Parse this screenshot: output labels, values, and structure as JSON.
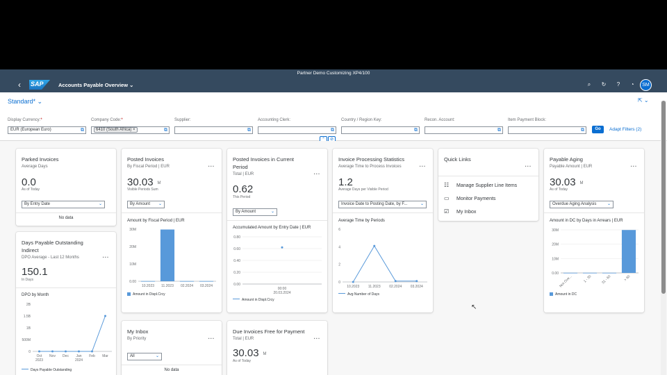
{
  "shell": {
    "system": "Partner Demo Customizing  XP4/100",
    "logo": "SAP",
    "app_title": "Accounts Payable Overview",
    "avatar": "SM"
  },
  "filterbar": {
    "variant": "Standard",
    "variant_star": "*",
    "filters": [
      {
        "label": "Display Currency:",
        "required": true,
        "value": "EUR (European Euro)",
        "token": false
      },
      {
        "label": "Company Code:",
        "required": true,
        "value": "6410 (South Africa)",
        "token": true
      },
      {
        "label": "Supplier:",
        "required": false,
        "value": "",
        "token": false
      },
      {
        "label": "Accounting Clerk:",
        "required": false,
        "value": "",
        "token": false
      },
      {
        "label": "Country / Region Key:",
        "required": false,
        "value": "",
        "token": false
      },
      {
        "label": "Recon. Account:",
        "required": false,
        "value": "",
        "token": false
      },
      {
        "label": "Item Payment Block:",
        "required": false,
        "value": "",
        "token": false
      }
    ],
    "go": "Go",
    "adapt": "Adapt Filters (2)"
  },
  "cards": {
    "parked": {
      "title": "Parked Invoices",
      "subtitle": "Average Days",
      "kpi": "0.0",
      "kpi_label": "As of Today",
      "select": "By Entry Date",
      "nodata": "No data"
    },
    "posted": {
      "title": "Posted Invoices",
      "subtitle": "By Fiscal Period | EUR",
      "kpi": "30.03",
      "unit": "M",
      "kpi_label": "Visible Periods Sum",
      "select": "By Amount",
      "chart_title": "Amount by Fiscal Period | EUR",
      "legend": "Amount in Displ.Crcy"
    },
    "posted_current": {
      "title": "Posted Invoices in Current Period",
      "subtitle": "Total | EUR",
      "kpi": "0.62",
      "kpi_label": "This Period",
      "select": "By Amount",
      "chart_title": "Accumulated Amount by Entry Date | EUR",
      "legend": "Amount in Displ.Crcy"
    },
    "processing": {
      "title": "Invoice Processing Statistics",
      "subtitle": "Average Time to Process Invoices",
      "kpi": "1.2",
      "kpi_label": "Average Days per Visible Period",
      "select": "Invoice Date to Posting Date, by F...",
      "chart_title": "Average Time by Periods",
      "legend": "Avg Number of Days"
    },
    "quicklinks": {
      "title": "Quick Links",
      "links": [
        {
          "icon": "list-icon",
          "label": "Manage Supplier Line Items"
        },
        {
          "icon": "monitor-icon",
          "label": "Monitor Payments"
        },
        {
          "icon": "checkbox-icon",
          "label": "My Inbox"
        }
      ]
    },
    "aging": {
      "title": "Payable Aging",
      "subtitle": "Payable Amount | EUR",
      "kpi": "30.03",
      "unit": "M",
      "kpi_label": "As of Today",
      "select": "Overdue Aging Analysis",
      "chart_title": "Amount in DC by Days in Arrears | EUR",
      "legend": "Amount in DC"
    },
    "dpo": {
      "title": "Days Payable Outstanding Indirect",
      "subtitle": "DPO Average - Last 12 Months",
      "kpi": "150.1",
      "kpi_label": "In Days",
      "chart_title": "DPO by Month",
      "legend": "Days Payable Outstanding"
    },
    "inbox": {
      "title": "My Inbox",
      "subtitle": "By Priority",
      "select": "All",
      "nodata": "No data"
    },
    "due": {
      "title": "Due Invoices Free for Payment",
      "subtitle": "Total | EUR",
      "kpi": "30.03",
      "unit": "M",
      "kpi_label": "As of Today"
    }
  },
  "chart_data": [
    {
      "type": "bar",
      "title": "Amount by Fiscal Period | EUR",
      "categories": [
        "10.2023",
        "11.2023",
        "02.2024",
        "03.2024"
      ],
      "series": [
        {
          "name": "Amount in Displ.Crcy",
          "values": [
            0.1,
            29.8,
            0.1,
            0.1
          ]
        }
      ],
      "yticks": [
        "0.00",
        "10M",
        "20M",
        "30M"
      ],
      "ylim": [
        0,
        30
      ]
    },
    {
      "type": "line",
      "title": "Accumulated Amount by Entry Date | EUR",
      "x": [
        "00:00\n20.03.2024"
      ],
      "series": [
        {
          "name": "Amount in Displ.Crcy",
          "values": [
            0.62
          ]
        }
      ],
      "yticks": [
        "0.00",
        "0.20",
        "0.40",
        "0.60",
        "0.80"
      ],
      "ylim": [
        0,
        0.8
      ]
    },
    {
      "type": "line",
      "title": "Average Time by Periods",
      "categories": [
        "10.2023",
        "11.2023",
        "02.2024",
        "03.2024"
      ],
      "series": [
        {
          "name": "Avg Number of Days",
          "values": [
            0,
            4.1,
            0.1,
            0.1
          ]
        }
      ],
      "yticks": [
        "0",
        "2",
        "4",
        "6"
      ],
      "ylim": [
        0,
        6
      ]
    },
    {
      "type": "bar",
      "title": "Amount in DC by Days in Arrears | EUR",
      "categories": [
        "Not Ove...",
        "1 - 30",
        "31 - 60",
        "> 60"
      ],
      "series": [
        {
          "name": "Amount in DC",
          "values": [
            0.1,
            0.1,
            0.1,
            29.9
          ]
        }
      ],
      "yticks": [
        "0.00",
        "10M",
        "20M",
        "30M"
      ],
      "ylim": [
        0,
        30
      ]
    },
    {
      "type": "line",
      "title": "DPO by Month",
      "categories": [
        "Oct\n2023",
        "Nov",
        "Dec",
        "Jan\n2024",
        "Feb",
        "Mar"
      ],
      "series": [
        {
          "name": "Days Payable Outstanding",
          "values": [
            0,
            0,
            0,
            0,
            0,
            1.5
          ]
        }
      ],
      "yticks": [
        "0",
        "500M",
        "1B",
        "1.5B",
        "2B"
      ],
      "ylim": [
        0,
        2
      ]
    }
  ],
  "colors": {
    "shell": "#354a5f",
    "accent": "#0a6ed1",
    "series": "#5899da"
  }
}
